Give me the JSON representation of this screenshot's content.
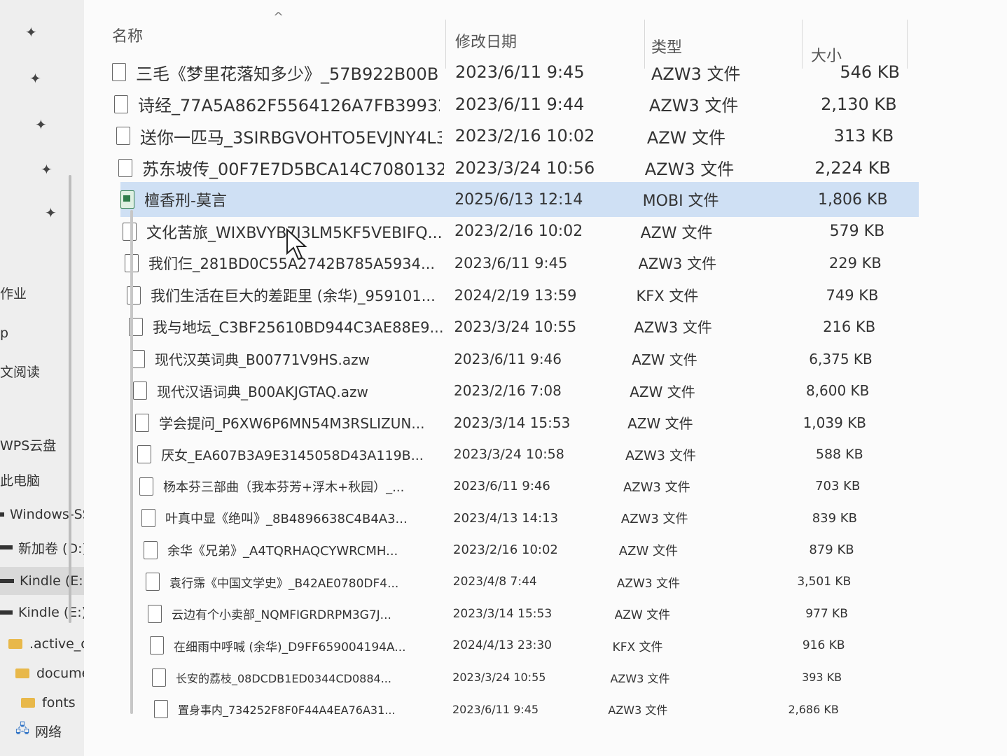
{
  "sidebar": {
    "items": [
      {
        "label": "作业"
      },
      {
        "label": "p"
      },
      {
        "label": "文阅读"
      },
      {
        "label": "WPS云盘"
      },
      {
        "label": "此电脑"
      },
      {
        "label": "Windows-SSD"
      },
      {
        "label": "新加卷 (D:)"
      },
      {
        "label": "Kindle (E:)"
      },
      {
        "label": "Kindle (E:)"
      },
      {
        "label": ".active_conte"
      },
      {
        "label": "documents"
      },
      {
        "label": "fonts"
      },
      {
        "label": "网络"
      }
    ]
  },
  "columns": {
    "name": "名称",
    "date": "修改日期",
    "type": "类型",
    "size": "大小"
  },
  "files": [
    {
      "name": "三毛《梦里花落知多少》_57B922B00B...",
      "date": "2023/6/11 9:45",
      "type": "AZW3 文件",
      "size": "546 KB"
    },
    {
      "name": "诗经_77A5A862F5564126A7FB39932...",
      "date": "2023/6/11 9:44",
      "type": "AZW3 文件",
      "size": "2,130 KB"
    },
    {
      "name": "送你一匹马_3SIRBGVOHTO5EVJNY4L3...",
      "date": "2023/2/16 10:02",
      "type": "AZW 文件",
      "size": "313 KB"
    },
    {
      "name": "苏东坡传_00F7E7D5BCA14C7080132F...",
      "date": "2023/3/24 10:56",
      "type": "AZW3 文件",
      "size": "2,224 KB"
    },
    {
      "name": "檀香刑-莫言",
      "date": "2025/6/13 12:14",
      "type": "MOBI 文件",
      "size": "1,806 KB"
    },
    {
      "name": "文化苦旅_WIXBVYB7I3LM5KF5VEBIFQ...",
      "date": "2023/2/16 10:02",
      "type": "AZW 文件",
      "size": "579 KB"
    },
    {
      "name": "我们仨_281BD0C55A2742B785A5934...",
      "date": "2023/6/11 9:45",
      "type": "AZW3 文件",
      "size": "229 KB"
    },
    {
      "name": "我们生活在巨大的差距里 (余华)_959101...",
      "date": "2024/2/19 13:59",
      "type": "KFX 文件",
      "size": "749 KB"
    },
    {
      "name": "我与地坛_C3BF25610BD944C3AE88E9...",
      "date": "2023/3/24 10:55",
      "type": "AZW3 文件",
      "size": "216 KB"
    },
    {
      "name": "现代汉英词典_B00771V9HS.azw",
      "date": "2023/6/11 9:46",
      "type": "AZW 文件",
      "size": "6,375 KB"
    },
    {
      "name": "现代汉语词典_B00AKJGTAQ.azw",
      "date": "2023/2/16 7:08",
      "type": "AZW 文件",
      "size": "8,600 KB"
    },
    {
      "name": "学会提问_P6XW6P6MN54M3RSLIZUN...",
      "date": "2023/3/14 15:53",
      "type": "AZW 文件",
      "size": "1,039 KB"
    },
    {
      "name": "厌女_EA607B3A9E3145058D43A119B...",
      "date": "2023/3/24 10:58",
      "type": "AZW3 文件",
      "size": "588 KB"
    },
    {
      "name": "杨本芬三部曲（我本芬芳+浮木+秋园）_...",
      "date": "2023/6/11 9:46",
      "type": "AZW3 文件",
      "size": "703 KB"
    },
    {
      "name": "叶真中显《绝叫》_8B4896638C4B4A3...",
      "date": "2023/4/13 14:13",
      "type": "AZW3 文件",
      "size": "839 KB"
    },
    {
      "name": "余华《兄弟》_A4TQRHAQCYWRCMH...",
      "date": "2023/2/16 10:02",
      "type": "AZW 文件",
      "size": "879 KB"
    },
    {
      "name": "袁行霈《中国文学史》_B42AE0780DF4...",
      "date": "2023/4/8 7:44",
      "type": "AZW3 文件",
      "size": "3,501 KB"
    },
    {
      "name": "云边有个小卖部_NQMFIGRDRPM3G7J...",
      "date": "2023/3/14 15:53",
      "type": "AZW 文件",
      "size": "977 KB"
    },
    {
      "name": "在细雨中呼喊 (余华)_D9FF659004194A...",
      "date": "2024/4/13 23:30",
      "type": "KFX 文件",
      "size": "916 KB"
    },
    {
      "name": "长安的荔枝_08DCDB1ED0344CD0884...",
      "date": "2023/3/24 10:55",
      "type": "AZW3 文件",
      "size": "393 KB"
    },
    {
      "name": "置身事内_734252F8F0F44A4EA76A31...",
      "date": "2023/6/11 9:45",
      "type": "AZW3 文件",
      "size": "2,686 KB"
    }
  ],
  "selected_index": 4
}
